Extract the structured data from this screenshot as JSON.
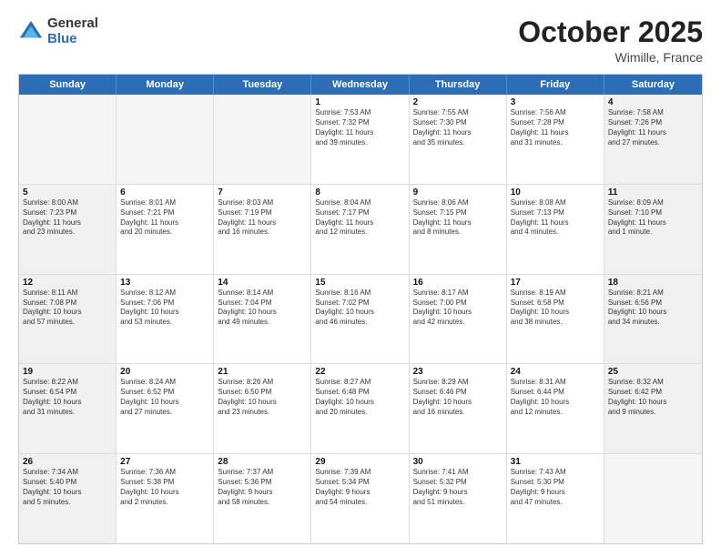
{
  "logo": {
    "general": "General",
    "blue": "Blue"
  },
  "title": "October 2025",
  "location": "Wimille, France",
  "days": [
    "Sunday",
    "Monday",
    "Tuesday",
    "Wednesday",
    "Thursday",
    "Friday",
    "Saturday"
  ],
  "rows": [
    [
      {
        "day": "",
        "text": "",
        "empty": true
      },
      {
        "day": "",
        "text": "",
        "empty": true
      },
      {
        "day": "",
        "text": "",
        "empty": true
      },
      {
        "day": "1",
        "text": "Sunrise: 7:53 AM\nSunset: 7:32 PM\nDaylight: 11 hours\nand 39 minutes."
      },
      {
        "day": "2",
        "text": "Sunrise: 7:55 AM\nSunset: 7:30 PM\nDaylight: 11 hours\nand 35 minutes."
      },
      {
        "day": "3",
        "text": "Sunrise: 7:56 AM\nSunset: 7:28 PM\nDaylight: 11 hours\nand 31 minutes."
      },
      {
        "day": "4",
        "text": "Sunrise: 7:58 AM\nSunset: 7:26 PM\nDaylight: 11 hours\nand 27 minutes.",
        "shade": true
      }
    ],
    [
      {
        "day": "5",
        "text": "Sunrise: 8:00 AM\nSunset: 7:23 PM\nDaylight: 11 hours\nand 23 minutes.",
        "shade": true
      },
      {
        "day": "6",
        "text": "Sunrise: 8:01 AM\nSunset: 7:21 PM\nDaylight: 11 hours\nand 20 minutes."
      },
      {
        "day": "7",
        "text": "Sunrise: 8:03 AM\nSunset: 7:19 PM\nDaylight: 11 hours\nand 16 minutes."
      },
      {
        "day": "8",
        "text": "Sunrise: 8:04 AM\nSunset: 7:17 PM\nDaylight: 11 hours\nand 12 minutes."
      },
      {
        "day": "9",
        "text": "Sunrise: 8:06 AM\nSunset: 7:15 PM\nDaylight: 11 hours\nand 8 minutes."
      },
      {
        "day": "10",
        "text": "Sunrise: 8:08 AM\nSunset: 7:13 PM\nDaylight: 11 hours\nand 4 minutes."
      },
      {
        "day": "11",
        "text": "Sunrise: 8:09 AM\nSunset: 7:10 PM\nDaylight: 11 hours\nand 1 minute.",
        "shade": true
      }
    ],
    [
      {
        "day": "12",
        "text": "Sunrise: 8:11 AM\nSunset: 7:08 PM\nDaylight: 10 hours\nand 57 minutes.",
        "shade": true
      },
      {
        "day": "13",
        "text": "Sunrise: 8:12 AM\nSunset: 7:06 PM\nDaylight: 10 hours\nand 53 minutes."
      },
      {
        "day": "14",
        "text": "Sunrise: 8:14 AM\nSunset: 7:04 PM\nDaylight: 10 hours\nand 49 minutes."
      },
      {
        "day": "15",
        "text": "Sunrise: 8:16 AM\nSunset: 7:02 PM\nDaylight: 10 hours\nand 46 minutes."
      },
      {
        "day": "16",
        "text": "Sunrise: 8:17 AM\nSunset: 7:00 PM\nDaylight: 10 hours\nand 42 minutes."
      },
      {
        "day": "17",
        "text": "Sunrise: 8:19 AM\nSunset: 6:58 PM\nDaylight: 10 hours\nand 38 minutes."
      },
      {
        "day": "18",
        "text": "Sunrise: 8:21 AM\nSunset: 6:56 PM\nDaylight: 10 hours\nand 34 minutes.",
        "shade": true
      }
    ],
    [
      {
        "day": "19",
        "text": "Sunrise: 8:22 AM\nSunset: 6:54 PM\nDaylight: 10 hours\nand 31 minutes.",
        "shade": true
      },
      {
        "day": "20",
        "text": "Sunrise: 8:24 AM\nSunset: 6:52 PM\nDaylight: 10 hours\nand 27 minutes."
      },
      {
        "day": "21",
        "text": "Sunrise: 8:26 AM\nSunset: 6:50 PM\nDaylight: 10 hours\nand 23 minutes."
      },
      {
        "day": "22",
        "text": "Sunrise: 8:27 AM\nSunset: 6:48 PM\nDaylight: 10 hours\nand 20 minutes."
      },
      {
        "day": "23",
        "text": "Sunrise: 8:29 AM\nSunset: 6:46 PM\nDaylight: 10 hours\nand 16 minutes."
      },
      {
        "day": "24",
        "text": "Sunrise: 8:31 AM\nSunset: 6:44 PM\nDaylight: 10 hours\nand 12 minutes."
      },
      {
        "day": "25",
        "text": "Sunrise: 8:32 AM\nSunset: 6:42 PM\nDaylight: 10 hours\nand 9 minutes.",
        "shade": true
      }
    ],
    [
      {
        "day": "26",
        "text": "Sunrise: 7:34 AM\nSunset: 5:40 PM\nDaylight: 10 hours\nand 5 minutes.",
        "shade": true
      },
      {
        "day": "27",
        "text": "Sunrise: 7:36 AM\nSunset: 5:38 PM\nDaylight: 10 hours\nand 2 minutes."
      },
      {
        "day": "28",
        "text": "Sunrise: 7:37 AM\nSunset: 5:36 PM\nDaylight: 9 hours\nand 58 minutes."
      },
      {
        "day": "29",
        "text": "Sunrise: 7:39 AM\nSunset: 5:34 PM\nDaylight: 9 hours\nand 54 minutes."
      },
      {
        "day": "30",
        "text": "Sunrise: 7:41 AM\nSunset: 5:32 PM\nDaylight: 9 hours\nand 51 minutes."
      },
      {
        "day": "31",
        "text": "Sunrise: 7:43 AM\nSunset: 5:30 PM\nDaylight: 9 hours\nand 47 minutes."
      },
      {
        "day": "",
        "text": "",
        "empty": true
      }
    ]
  ]
}
